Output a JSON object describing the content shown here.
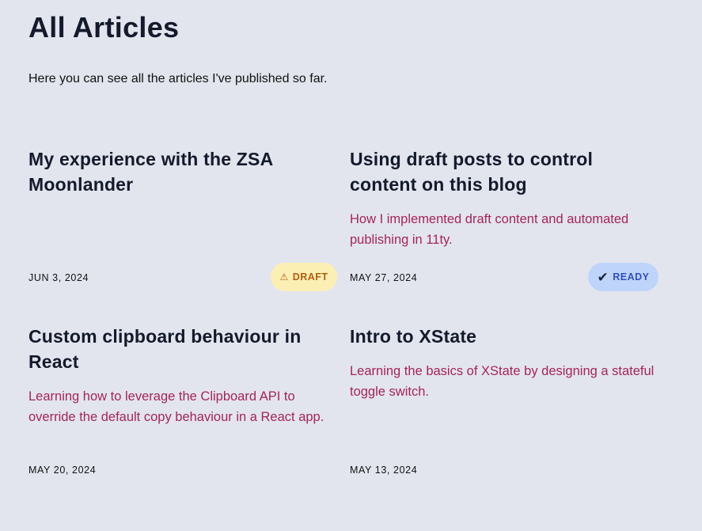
{
  "header": {
    "title": "All Articles",
    "intro": "Here you can see all the articles I've published so far."
  },
  "articles": [
    {
      "title": "My experience with the ZSA Moonlander",
      "description": "",
      "date": "JUN 3, 2024",
      "badge": {
        "label": "DRAFT",
        "icon": "warning-icon",
        "glyph": "⚠",
        "color": "#b85c0e",
        "background": "#fcefb4"
      }
    },
    {
      "title": "Using draft posts to control content on this blog",
      "description": "How I implemented draft content and automated publishing in 11ty.",
      "date": "MAY 27, 2024",
      "badge": {
        "label": "READY",
        "icon": "checkmark-icon",
        "glyph": "✔",
        "color": "#2f4fc2",
        "background": "#bfd4fb"
      }
    },
    {
      "title": "Custom clipboard behaviour in React",
      "description": "Learning how to leverage the Clipboard API to override the default copy behaviour in a React app.",
      "date": "MAY 20, 2024"
    },
    {
      "title": "Intro to XState",
      "description": "Learning the basics of XState by designing a stateful toggle switch.",
      "date": "MAY 13, 2024"
    }
  ],
  "colors": {
    "background": "#e2e5ee",
    "heading": "#141a2b",
    "description": "#a5245a"
  }
}
